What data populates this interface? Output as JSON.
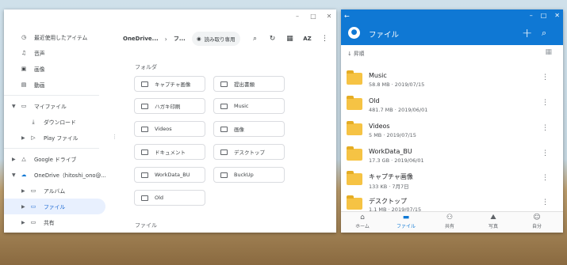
{
  "files_window": {
    "controls": [
      "–",
      "□",
      "✕"
    ],
    "sidebar": [
      {
        "label": "最近使用したアイテム",
        "icon": "clock-icon"
      },
      {
        "label": "音声",
        "icon": "headphones-icon"
      },
      {
        "label": "画像",
        "icon": "image-icon"
      },
      {
        "label": "動画",
        "icon": "video-icon"
      },
      {
        "label": "マイファイル",
        "icon": "laptop-icon"
      },
      {
        "label": "ダウンロード",
        "icon": "download-icon"
      },
      {
        "label": "Play ファイル",
        "icon": "play-icon"
      },
      {
        "label": "Google ドライブ",
        "icon": "drive-icon"
      },
      {
        "label": "OneDrive（hitoshi_ono@...",
        "icon": "cloud-icon"
      },
      {
        "label": "アルバム",
        "icon": "folder-icon"
      },
      {
        "label": "ファイル",
        "icon": "folder-icon"
      },
      {
        "label": "共有",
        "icon": "folder-icon"
      }
    ],
    "breadcrumb": [
      "OneDrive...",
      "フ..."
    ],
    "read_only_chip": "読み取り専用",
    "toolbar_icons": [
      "search-icon",
      "refresh-icon",
      "grid-view-icon",
      "sort-az-icon",
      "more-vert-icon"
    ],
    "sort_label": "AZ",
    "folders_heading": "フォルダ",
    "folders": [
      "キャプチャ画像",
      "提出書類",
      "ハガキ印刷",
      "Music",
      "Videos",
      "画像",
      "ドキュメント",
      "デスクトップ",
      "WorkData_BU",
      "BuckUp",
      "Old"
    ],
    "files_heading": "ファイル"
  },
  "onedrive_window": {
    "title": "ファイル",
    "sort_label": "昇順",
    "items": [
      {
        "name": "Music",
        "meta": "58.8 MB · 2019/07/15"
      },
      {
        "name": "Old",
        "meta": "481.7 MB · 2019/06/01"
      },
      {
        "name": "Videos",
        "meta": "5 MB · 2019/07/15"
      },
      {
        "name": "WorkData_BU",
        "meta": "17.3 GB · 2019/06/01"
      },
      {
        "name": "キャプチャ画像",
        "meta": "133 KB · 7月7日"
      },
      {
        "name": "デスクトップ",
        "meta": "1.1 MB · 2019/07/15"
      }
    ],
    "nav": [
      {
        "label": "ホーム",
        "icon": "home-icon"
      },
      {
        "label": "ファイル",
        "icon": "folder-icon"
      },
      {
        "label": "共有",
        "icon": "people-icon"
      },
      {
        "label": "写真",
        "icon": "photo-icon"
      },
      {
        "label": "自分",
        "icon": "person-icon"
      }
    ],
    "accent": "#0f78d4"
  }
}
